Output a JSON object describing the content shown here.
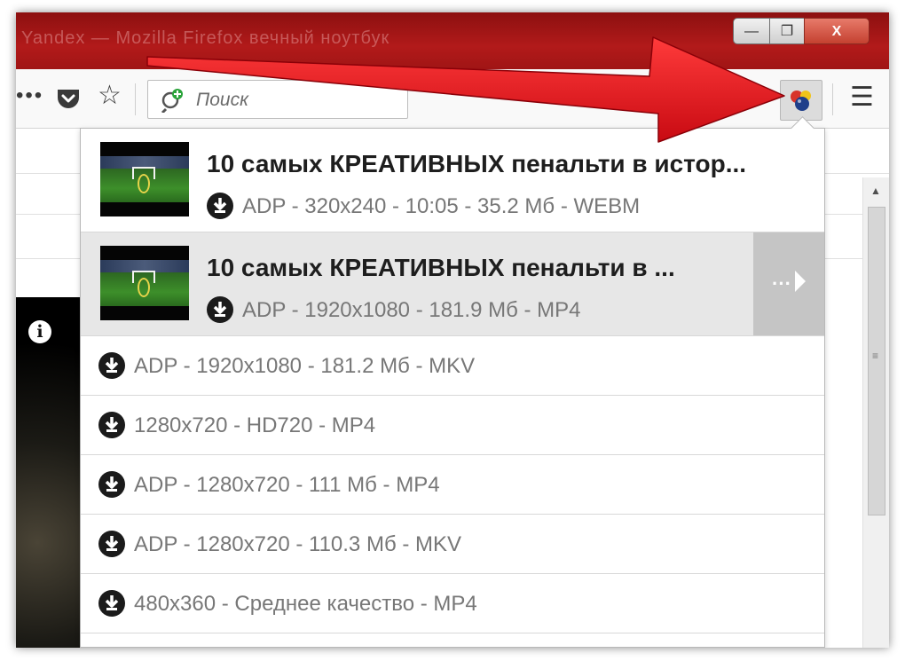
{
  "window": {
    "controls": {
      "minimize": "—",
      "maximize": "❐",
      "close": "X"
    },
    "title_text": "Yandex — Mozilla Firefox вечный ноутбук"
  },
  "toolbar": {
    "more_icon": "•••",
    "search_placeholder": "Поиск",
    "menu_icon": "☰"
  },
  "dropdown": {
    "videos": [
      {
        "title": "10 самых КРЕАТИВНЫХ пенальти в истор...",
        "meta": "ADP - 320x240 - 10:05 - 35.2 Мб - WEBM"
      },
      {
        "title": "10 самых КРЕАТИВНЫХ пенальти в ...",
        "meta": "ADP - 1920x1080 - 181.9 Мб - MP4",
        "more_label": "···"
      }
    ],
    "formats": [
      "ADP - 1920x1080 - 181.2 Мб - MKV",
      "1280x720 - HD720 - MP4",
      "ADP - 1280x720 - 111 Мб - MP4",
      "ADP - 1280x720 - 110.3 Мб - MKV",
      "480x360 - Среднее качество - MP4"
    ]
  },
  "page": {
    "info_icon": "i"
  },
  "colors": {
    "arrow": "#e0101a",
    "titlebar": "#a81818",
    "active_row": "#e7e7e7"
  }
}
